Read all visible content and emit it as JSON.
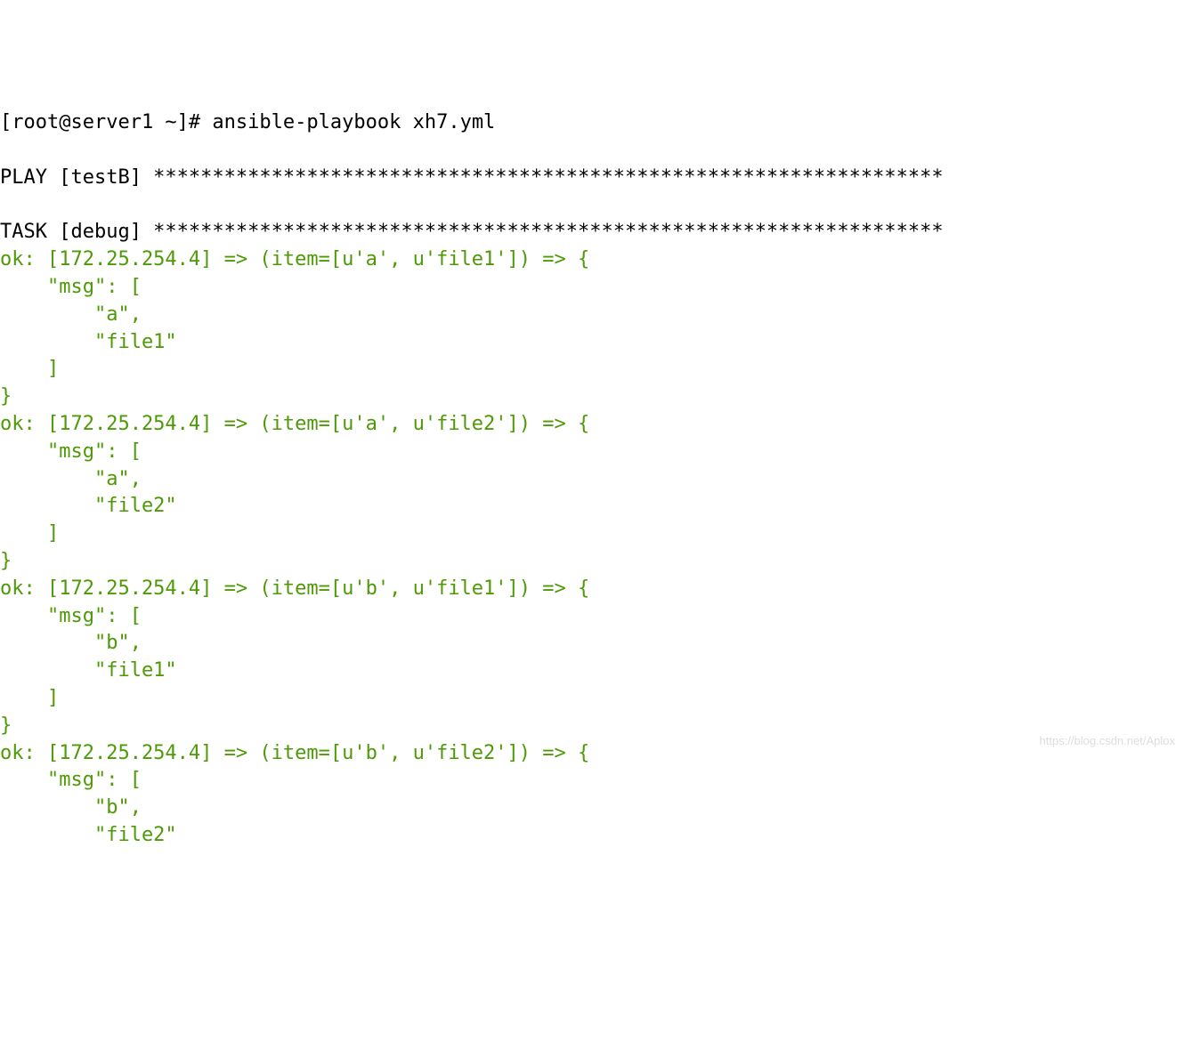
{
  "prompt": "[root@server1 ~]# ",
  "command": "ansible-playbook xh7.yml",
  "blank1": "",
  "play_header": "PLAY [testB] *******************************************************************",
  "blank2": "",
  "task_header": "TASK [debug] *******************************************************************",
  "items": [
    {
      "line1": "ok: [172.25.254.4] => (item=[u'a', u'file1']) => {",
      "line2": "    \"msg\": [",
      "line3": "        \"a\", ",
      "line4": "        \"file1\"",
      "line5": "    ]",
      "line6": "}"
    },
    {
      "line1": "ok: [172.25.254.4] => (item=[u'a', u'file2']) => {",
      "line2": "    \"msg\": [",
      "line3": "        \"a\", ",
      "line4": "        \"file2\"",
      "line5": "    ]",
      "line6": "}"
    },
    {
      "line1": "ok: [172.25.254.4] => (item=[u'b', u'file1']) => {",
      "line2": "    \"msg\": [",
      "line3": "        \"b\", ",
      "line4": "        \"file1\"",
      "line5": "    ]",
      "line6": "}"
    },
    {
      "line1": "ok: [172.25.254.4] => (item=[u'b', u'file2']) => {",
      "line2": "    \"msg\": [",
      "line3": "        \"b\", ",
      "line4": "        \"file2\""
    }
  ],
  "watermark": "https://blog.csdn.net/Aplox"
}
